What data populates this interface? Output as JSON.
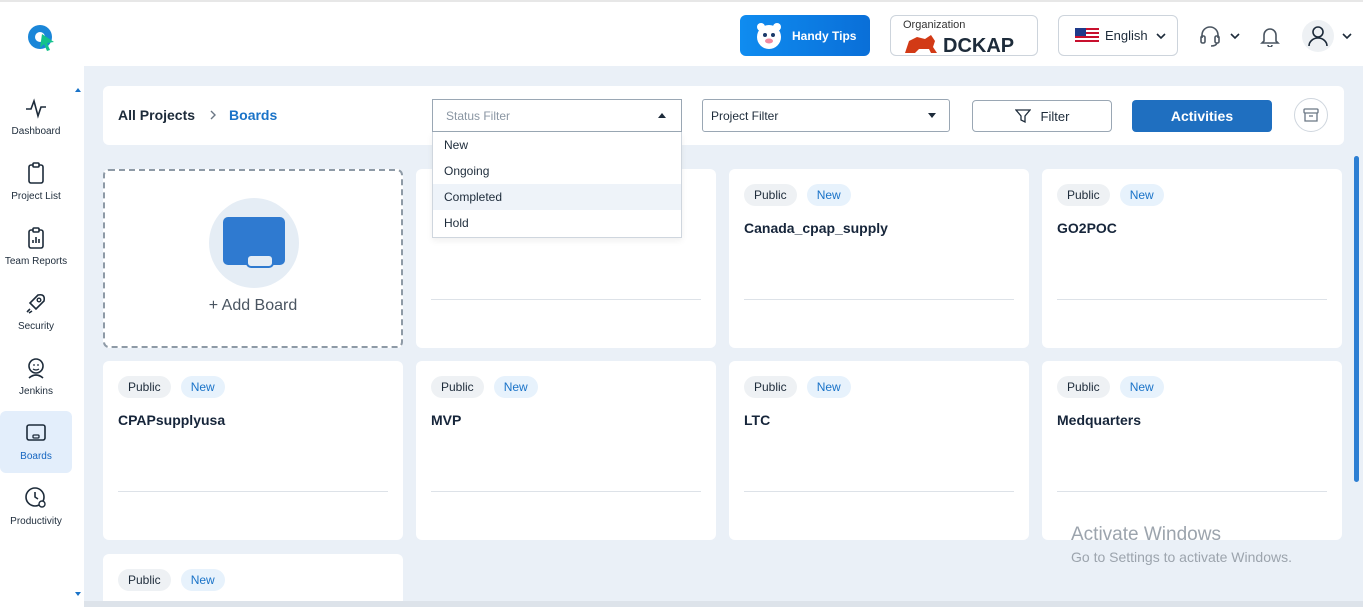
{
  "header": {
    "handy_tips_label": "Handy Tips",
    "organization_label": "Organization",
    "organization_name": "DCKAP",
    "language": "English"
  },
  "sidebar": {
    "items": [
      {
        "label": "Dashboard",
        "icon": "pulse-icon"
      },
      {
        "label": "Project List",
        "icon": "clipboard-icon"
      },
      {
        "label": "Team Reports",
        "icon": "report-icon"
      },
      {
        "label": "Security",
        "icon": "rocket-icon"
      },
      {
        "label": "Jenkins",
        "icon": "jenkins-icon"
      },
      {
        "label": "Boards",
        "icon": "board-icon",
        "active": true
      },
      {
        "label": "Productivity",
        "icon": "clock-gear-icon"
      }
    ]
  },
  "breadcrumb": {
    "root": "All Projects",
    "current": "Boards"
  },
  "filters": {
    "status_placeholder": "Status Filter",
    "status_options": [
      "New",
      "Ongoing",
      "Completed",
      "Hold"
    ],
    "status_highlighted": "Completed",
    "project_filter": "Project Filter",
    "filter_label": "Filter",
    "activities_label": "Activities"
  },
  "add_board_label": "+ Add Board",
  "boards": [
    {
      "visibility": "",
      "status": "",
      "name": ""
    },
    {
      "visibility": "Public",
      "status": "New",
      "name": "Canada_cpap_supply"
    },
    {
      "visibility": "Public",
      "status": "New",
      "name": "GO2POC"
    },
    {
      "visibility": "Public",
      "status": "New",
      "name": "CPAPsupplyusa"
    },
    {
      "visibility": "Public",
      "status": "New",
      "name": "MVP"
    },
    {
      "visibility": "Public",
      "status": "New",
      "name": "LTC"
    },
    {
      "visibility": "Public",
      "status": "New",
      "name": "Medquarters"
    },
    {
      "visibility": "Public",
      "status": "New",
      "name": ""
    }
  ],
  "watermark": {
    "line1": "Activate Windows",
    "line2": "Go to Settings to activate Windows."
  },
  "colors": {
    "accent": "#1f6fc0",
    "link": "#1a73c8",
    "background": "#eaf0f7"
  }
}
